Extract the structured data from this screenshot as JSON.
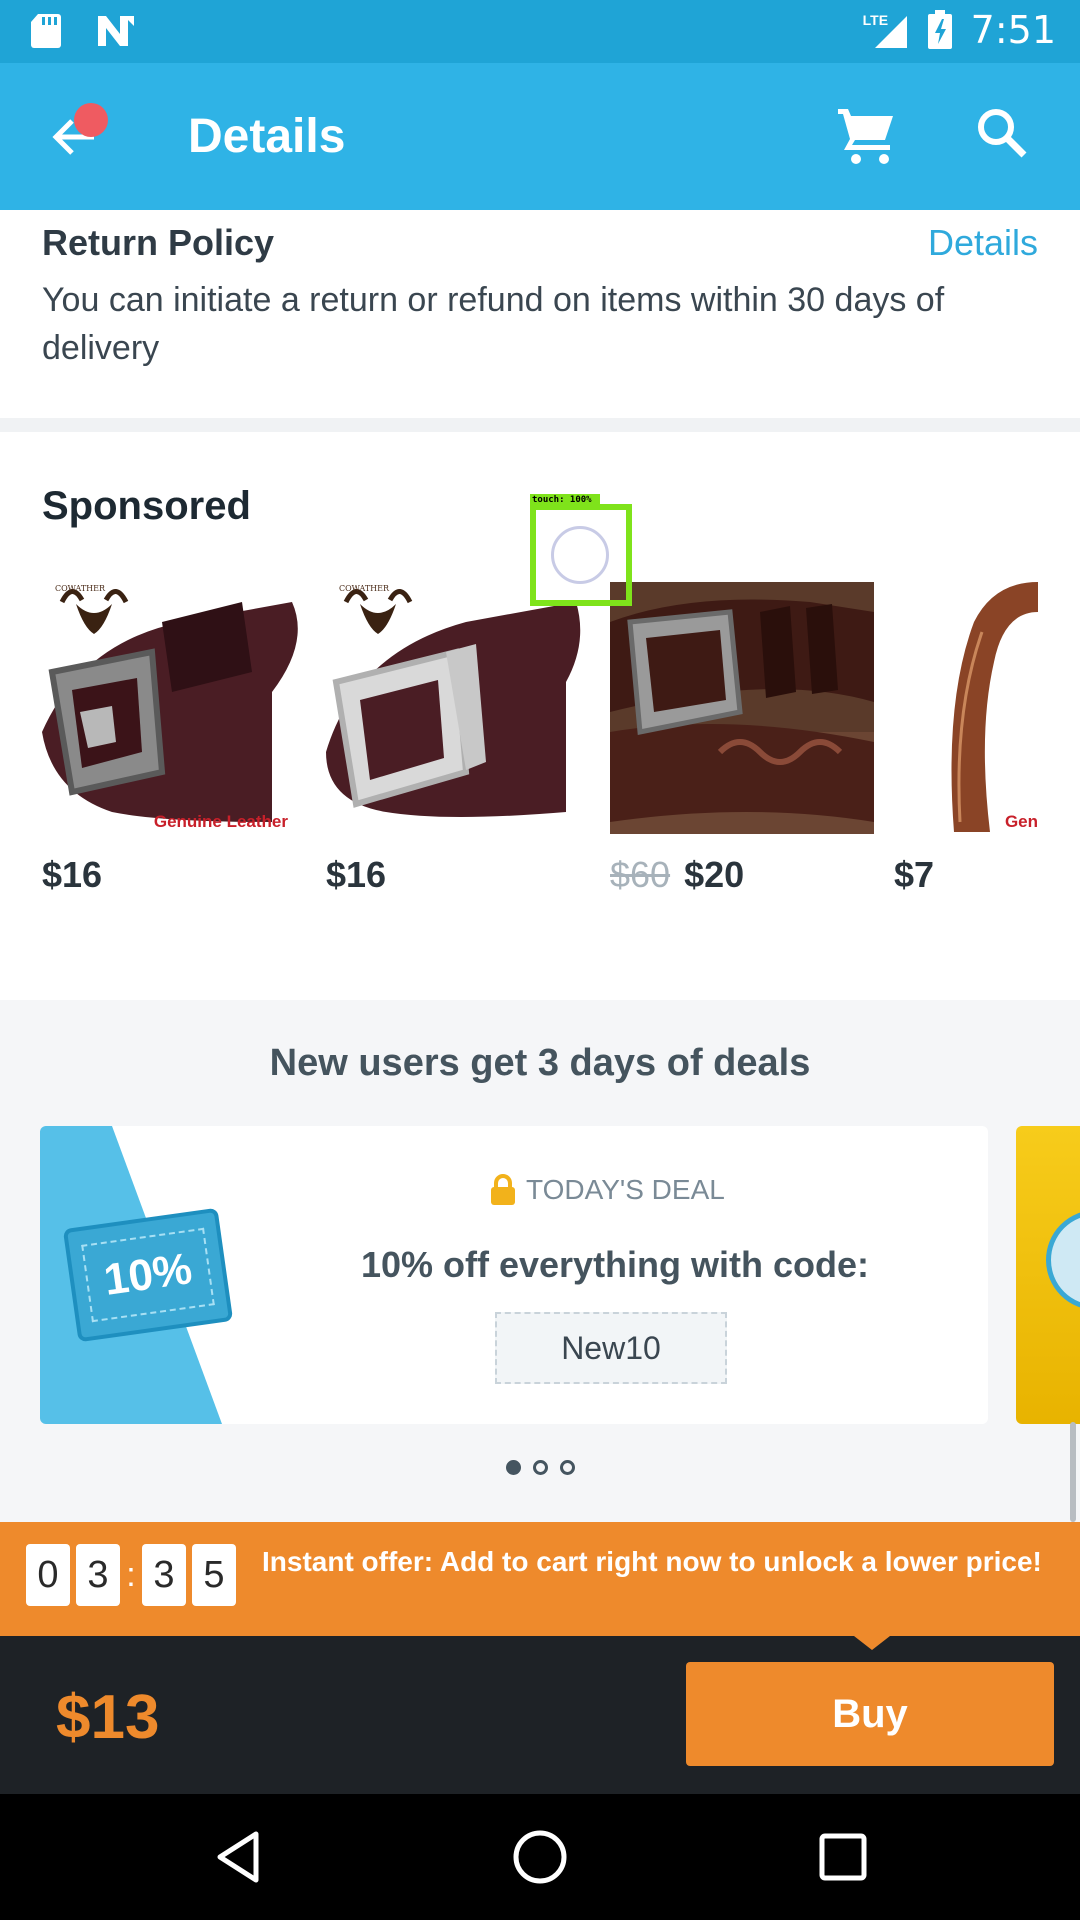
{
  "status_bar": {
    "time": "7:51",
    "network": "LTE",
    "icons": [
      "sd-card-icon",
      "n-notification-icon",
      "signal-icon",
      "battery-charging-icon"
    ]
  },
  "toolbar": {
    "title": "Details",
    "icons": [
      "back-arrow-icon",
      "cart-icon",
      "search-icon"
    ]
  },
  "return_policy": {
    "title": "Return Policy",
    "details_link": "Details",
    "text": "You can initiate a return or refund on items within 30 days of delivery"
  },
  "sponsored": {
    "title": "Sponsored",
    "products": [
      {
        "price": "$16",
        "old_price": "",
        "brand": "COWATHER",
        "label": "Genuine Leather"
      },
      {
        "price": "$16",
        "old_price": "",
        "brand": "COWATHER",
        "label": ""
      },
      {
        "price": "$20",
        "old_price": "$60",
        "brand": "",
        "label": ""
      },
      {
        "price": "$7",
        "old_price": "",
        "brand": "",
        "label": "Gen"
      }
    ]
  },
  "touch_overlay": {
    "label": "touch: 100%"
  },
  "deals": {
    "title": "New users get 3 days of deals",
    "card": {
      "coupon_text": "10%",
      "tag": "TODAY'S DEAL",
      "headline": "10% off everything with code:",
      "code": "New10"
    },
    "dots": 3,
    "active_dot": 0
  },
  "offer": {
    "timer": [
      "0",
      "3",
      "3",
      "5"
    ],
    "text": "Instant offer: Add to cart right now to unlock a lower price!"
  },
  "buy_bar": {
    "price": "$13",
    "button": "Buy"
  },
  "colors": {
    "primary": "#2fb3e6",
    "status": "#1fa4d6",
    "accent": "#ee8a2c",
    "link": "#2fa9dc"
  }
}
